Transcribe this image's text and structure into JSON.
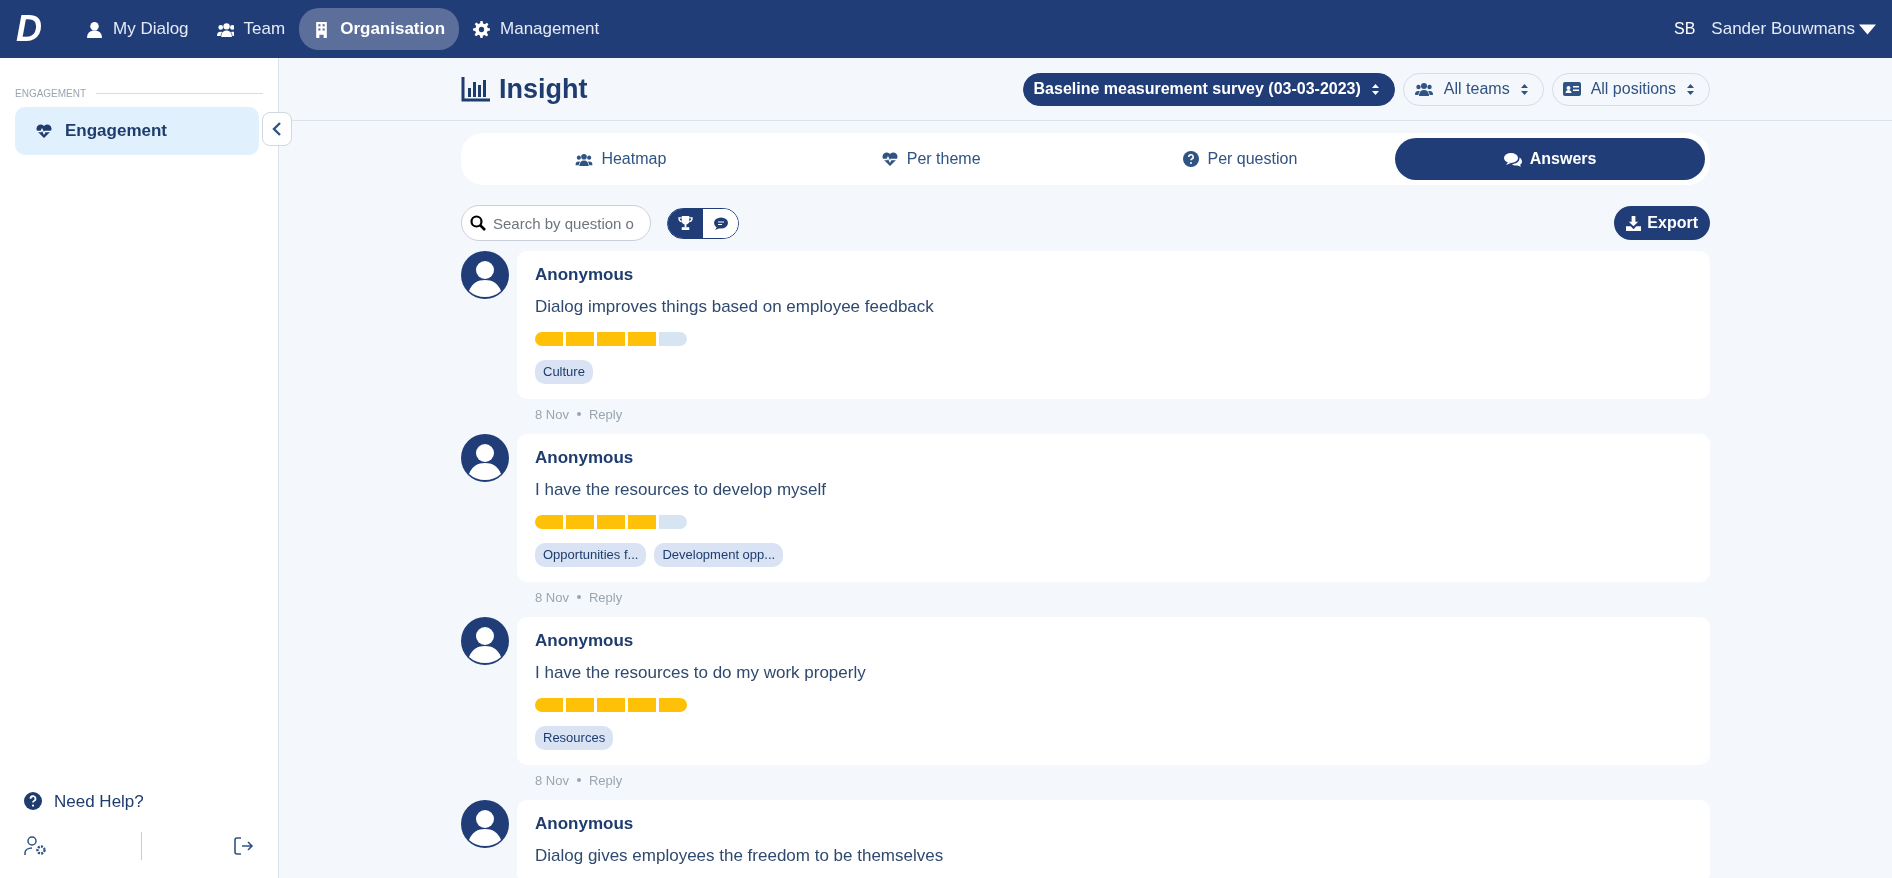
{
  "navbar": {
    "logo": "D",
    "items": [
      {
        "label": "My Dialog",
        "selected": false
      },
      {
        "label": "Team",
        "selected": false
      },
      {
        "label": "Organisation",
        "selected": true
      },
      {
        "label": "Management",
        "selected": false
      }
    ],
    "user_initials": "SB",
    "user_name": "Sander Bouwmans"
  },
  "sidebar": {
    "section": "ENGAGEMENT",
    "items": [
      {
        "label": "Engagement",
        "selected": true
      }
    ],
    "help": "Need Help?"
  },
  "page": {
    "title": "Insight",
    "filters": [
      {
        "label": "Baseline measurement survey (03-03-2023)",
        "selected": true
      },
      {
        "label": "All teams",
        "selected": false
      },
      {
        "label": "All positions",
        "selected": false
      }
    ]
  },
  "tabs": [
    {
      "label": "Heatmap",
      "selected": false
    },
    {
      "label": "Per theme",
      "selected": false
    },
    {
      "label": "Per question",
      "selected": false
    },
    {
      "label": "Answers",
      "selected": true
    }
  ],
  "search": {
    "placeholder": "Search by question o"
  },
  "view_toggle": [
    {
      "selected": true
    },
    {
      "selected": false
    }
  ],
  "export": "Export",
  "answers": [
    {
      "author": "Anonymous",
      "question": "Dialog improves things based on employee feedback",
      "stars": 4,
      "tags": [
        "Culture"
      ],
      "date": "8 Nov",
      "action": "Reply"
    },
    {
      "author": "Anonymous",
      "question": "I have the resources to develop myself",
      "stars": 4,
      "tags": [
        "Opportunities f...",
        "Development opp..."
      ],
      "date": "8 Nov",
      "action": "Reply"
    },
    {
      "author": "Anonymous",
      "question": "I have the resources to do my work properly",
      "stars": 5,
      "tags": [
        "Resources"
      ],
      "date": "8 Nov",
      "action": "Reply"
    },
    {
      "author": "Anonymous",
      "question": "Dialog gives employees the freedom to be themselves"
    }
  ]
}
